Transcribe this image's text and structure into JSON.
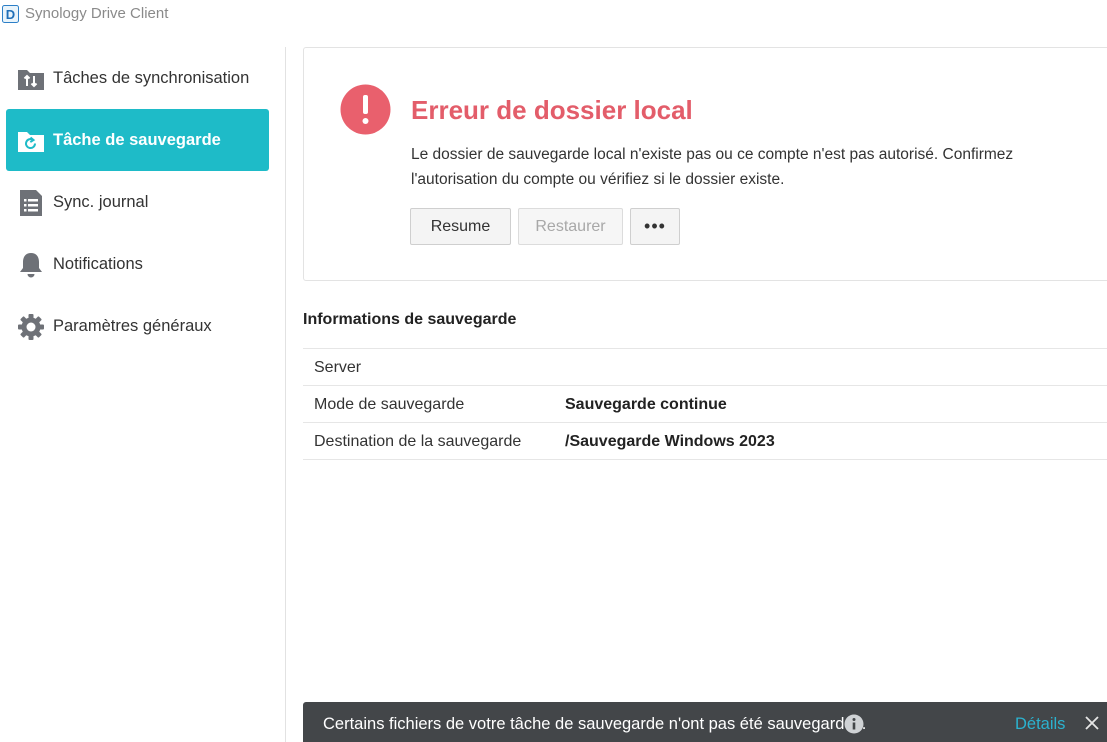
{
  "app": {
    "title": "Synology Drive Client",
    "logo_letter": "D"
  },
  "sidebar": {
    "items": [
      {
        "label": "Tâches de synchronisation",
        "icon": "sync-folder-icon",
        "active": false
      },
      {
        "label": "Tâche de sauvegarde",
        "icon": "backup-folder-icon",
        "active": true
      },
      {
        "label": "Sync. journal",
        "icon": "log-list-icon",
        "active": false
      },
      {
        "label": "Notifications",
        "icon": "bell-icon",
        "active": false
      },
      {
        "label": "Paramètres généraux",
        "icon": "gear-icon",
        "active": false
      }
    ]
  },
  "error": {
    "title": "Erreur de dossier local",
    "description": "Le dossier de sauvegarde local n'existe pas ou ce compte n'est pas autorisé. Confirmez l'autorisation du compte ou vérifiez si le dossier existe.",
    "icon": "exclamation-circle-icon",
    "buttons": {
      "resume": "Resume",
      "restore": "Restaurer",
      "more": "•••"
    }
  },
  "backup_info": {
    "title": "Informations de sauvegarde",
    "rows": [
      {
        "label": "Server",
        "value": ""
      },
      {
        "label": "Mode de sauvegarde",
        "value": "Sauvegarde continue"
      },
      {
        "label": "Destination de la sauvegarde",
        "value": "/Sauvegarde Windows 2023"
      }
    ]
  },
  "toast": {
    "message": "Certains fichiers de votre tâche de sauvegarde n'ont pas été sauvegardés.",
    "details_label": "Détails"
  },
  "colors": {
    "accent": "#1ebbc8",
    "error": "#e35d6a",
    "toast_bg": "#434649",
    "link": "#2bb2cf"
  }
}
